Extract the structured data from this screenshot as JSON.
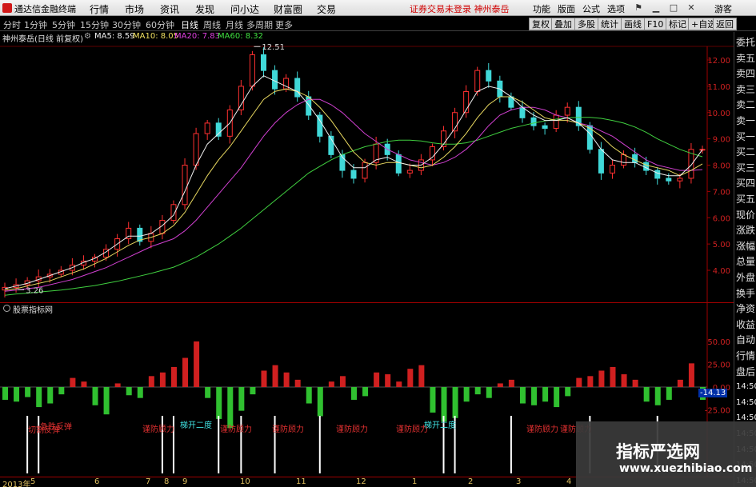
{
  "app": {
    "title": "通达信金融终端",
    "logo_icon": "tdx-logo-icon"
  },
  "menu": {
    "items": [
      "行情",
      "市场",
      "资讯",
      "发现",
      "问小达",
      "财富圈",
      "交易"
    ],
    "promo": "证券交易未登录  神州泰岳",
    "right_items": [
      "功能",
      "版面",
      "公式",
      "选项"
    ],
    "guest": "游客"
  },
  "periods": [
    "分时",
    "1分钟",
    "5分钟",
    "15分钟",
    "30分钟",
    "60分钟",
    "日线",
    "周线",
    "月线",
    "多周期",
    "更多"
  ],
  "active_period": "日线",
  "right_buttons": [
    "复权",
    "叠加",
    "多股",
    "统计",
    "画线",
    "F10",
    "标记",
    "+自选",
    "返回"
  ],
  "stock": {
    "name_line": "神州泰岳(日线 前复权)",
    "ma": [
      {
        "label": "MA5: 8.59",
        "color": "#f0f0f0"
      },
      {
        "label": "MA10: 8.05",
        "color": "#f0e060"
      },
      {
        "label": "MA20: 7.83",
        "color": "#e040e0"
      },
      {
        "label": "MA60: 8.32",
        "color": "#40e040"
      }
    ]
  },
  "sidebar": [
    "委托",
    "卖五",
    "卖四",
    "卖三",
    "卖二",
    "卖一",
    "买一",
    "买二",
    "买三",
    "买四",
    "买五",
    "现价",
    "涨跌",
    "涨幅",
    "总量",
    "外盘",
    "换手",
    "净资",
    "收益",
    "自动",
    "行情",
    "盘后",
    "14:50",
    "14:50",
    "14:50",
    "14:50",
    "14:50",
    "14:50",
    "14:50"
  ],
  "indicator": {
    "title": "股票指标网",
    "current_value": "-14.13",
    "labels": [
      "切割反弹",
      "急跌反弹",
      "谨防顾力",
      "谨防顾力",
      "谨防顾力",
      "谨防顾力",
      "谨防顾力",
      "梯开二度",
      "梯开二度",
      "谨防顾力",
      "谨防顾力"
    ]
  },
  "dates": [
    "2013年",
    "5",
    "6",
    "7",
    "8",
    "9",
    "10",
    "11",
    "12",
    "1",
    "2",
    "3",
    "4"
  ],
  "watermark": {
    "cn": "指标严选网",
    "url": "www.xuezhibiao.com"
  },
  "chart_data": {
    "type": "candlestick",
    "title": "神州泰岳(日线 前复权)",
    "ylim": [
      3.0,
      13.0
    ],
    "yticks": [
      4.0,
      5.0,
      6.0,
      7.0,
      8.0,
      9.0,
      10.0,
      11.0,
      12.0
    ],
    "annotations": [
      {
        "text": "12.51",
        "value": 12.51
      },
      {
        "text": "3.26",
        "value": 3.26
      }
    ],
    "close": [
      3.35,
      3.45,
      3.6,
      3.75,
      3.85,
      4.0,
      4.2,
      4.35,
      4.5,
      4.8,
      5.2,
      5.6,
      5.1,
      5.4,
      5.9,
      6.5,
      8.0,
      9.2,
      9.6,
      9.1,
      10.1,
      11.0,
      12.2,
      11.6,
      10.9,
      11.3,
      10.6,
      9.9,
      9.1,
      8.4,
      7.8,
      7.5,
      8.1,
      8.8,
      8.4,
      7.7,
      7.8,
      8.2,
      8.7,
      9.3,
      10.0,
      10.8,
      11.6,
      11.2,
      10.6,
      10.2,
      9.8,
      9.5,
      9.4,
      9.9,
      10.2,
      9.5,
      8.6,
      7.7,
      8.0,
      8.4,
      8.1,
      7.8,
      7.5,
      7.4,
      7.5,
      8.6,
      8.6
    ],
    "ma5": [
      3.3,
      3.4,
      3.5,
      3.65,
      3.8,
      3.95,
      4.1,
      4.3,
      4.45,
      4.7,
      5.0,
      5.3,
      5.3,
      5.4,
      5.7,
      6.1,
      7.0,
      8.0,
      8.8,
      9.2,
      9.6,
      10.3,
      11.0,
      11.4,
      11.2,
      11.0,
      10.8,
      10.3,
      9.7,
      9.0,
      8.3,
      7.9,
      7.9,
      8.2,
      8.3,
      8.1,
      8.0,
      8.0,
      8.3,
      8.8,
      9.4,
      10.1,
      10.8,
      11.0,
      10.9,
      10.6,
      10.2,
      9.9,
      9.7,
      9.7,
      9.8,
      9.6,
      9.2,
      8.6,
      8.2,
      8.1,
      8.1,
      7.9,
      7.7,
      7.6,
      7.6,
      8.0,
      8.59
    ],
    "ma10": [
      3.25,
      3.3,
      3.4,
      3.5,
      3.6,
      3.75,
      3.9,
      4.05,
      4.25,
      4.45,
      4.7,
      4.95,
      5.15,
      5.25,
      5.4,
      5.7,
      6.2,
      6.9,
      7.6,
      8.2,
      8.7,
      9.3,
      9.9,
      10.5,
      10.8,
      10.9,
      10.8,
      10.6,
      10.2,
      9.7,
      9.1,
      8.5,
      8.1,
      8.0,
      8.1,
      8.1,
      8.0,
      7.9,
      8.0,
      8.3,
      8.7,
      9.2,
      9.8,
      10.3,
      10.6,
      10.6,
      10.4,
      10.1,
      9.8,
      9.7,
      9.7,
      9.6,
      9.4,
      9.1,
      8.7,
      8.4,
      8.2,
      8.0,
      7.9,
      7.8,
      7.6,
      7.8,
      8.05
    ],
    "ma20": [
      3.2,
      3.25,
      3.3,
      3.35,
      3.45,
      3.55,
      3.65,
      3.8,
      3.95,
      4.1,
      4.3,
      4.5,
      4.7,
      4.9,
      5.05,
      5.2,
      5.5,
      5.9,
      6.4,
      6.9,
      7.4,
      7.9,
      8.5,
      9.1,
      9.6,
      10.0,
      10.3,
      10.5,
      10.5,
      10.3,
      10.0,
      9.6,
      9.2,
      8.9,
      8.6,
      8.4,
      8.2,
      8.1,
      8.0,
      8.1,
      8.3,
      8.6,
      9.0,
      9.5,
      9.9,
      10.1,
      10.2,
      10.2,
      10.1,
      9.9,
      9.8,
      9.6,
      9.5,
      9.3,
      9.1,
      8.8,
      8.5,
      8.2,
      8.0,
      7.9,
      7.8,
      7.8,
      7.83
    ],
    "ma60": [
      3.05,
      3.1,
      3.13,
      3.17,
      3.21,
      3.25,
      3.3,
      3.36,
      3.42,
      3.5,
      3.58,
      3.68,
      3.78,
      3.88,
      4.0,
      4.12,
      4.3,
      4.5,
      4.75,
      5.0,
      5.3,
      5.6,
      5.95,
      6.3,
      6.65,
      7.0,
      7.35,
      7.7,
      7.95,
      8.2,
      8.4,
      8.55,
      8.7,
      8.8,
      8.9,
      8.95,
      8.95,
      8.92,
      8.85,
      8.8,
      8.8,
      8.85,
      8.95,
      9.1,
      9.25,
      9.4,
      9.5,
      9.6,
      9.68,
      9.75,
      9.8,
      9.82,
      9.82,
      9.78,
      9.7,
      9.6,
      9.45,
      9.25,
      9.0,
      8.8,
      8.6,
      8.45,
      8.32
    ],
    "indicator_values": [
      -14,
      -16,
      -11,
      -22,
      -18,
      -8,
      10,
      6,
      -20,
      -30,
      4,
      -9,
      -12,
      12,
      16,
      22,
      32,
      50,
      -12,
      -35,
      -45,
      -26,
      -8,
      18,
      24,
      16,
      8,
      -18,
      -32,
      6,
      12,
      -14,
      -10,
      16,
      14,
      6,
      20,
      24,
      -28,
      -38,
      -34,
      -16,
      -8,
      -12,
      4,
      8,
      -18,
      -20,
      -16,
      -22,
      -10,
      10,
      12,
      18,
      22,
      14,
      8,
      -16,
      -20,
      -14,
      8,
      26,
      -14
    ],
    "signal_lines": [
      {
        "color": "#ffffff",
        "x_index": [
          2,
          3,
          14,
          15,
          19,
          21,
          24,
          28,
          39,
          40,
          45,
          52,
          58
        ]
      }
    ]
  }
}
